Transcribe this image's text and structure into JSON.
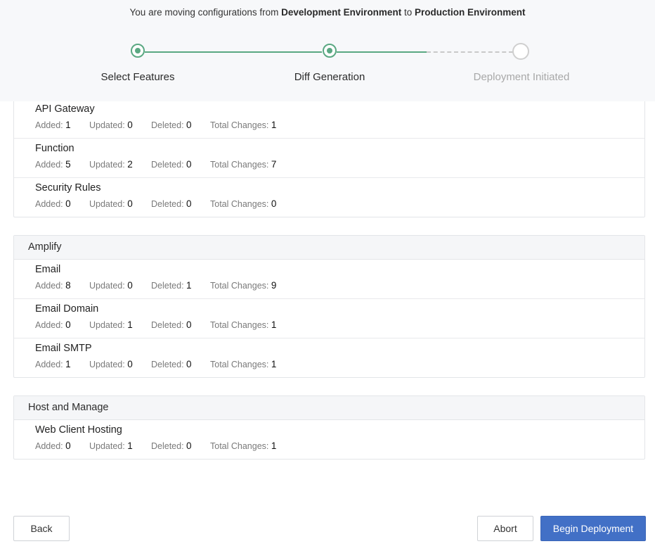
{
  "header": {
    "subtitle_prefix": "You are moving configurations from ",
    "source_env": "Development Environment",
    "subtitle_mid": " to ",
    "target_env": "Production Environment"
  },
  "stepper": {
    "steps": [
      {
        "label": "Select Features",
        "status": "completed"
      },
      {
        "label": "Diff Generation",
        "status": "current"
      },
      {
        "label": "Deployment Initiated",
        "status": "pending"
      }
    ],
    "colors": {
      "completed": "#5aa882",
      "pending": "#cfcfcf"
    }
  },
  "stat_labels": {
    "added": "Added: ",
    "updated": "Updated: ",
    "deleted": "Deleted: ",
    "total": "Total Changes: "
  },
  "groups": [
    {
      "title": "",
      "items": [
        {
          "name": "API Gateway",
          "added": "1",
          "updated": "0",
          "deleted": "0",
          "total": "1"
        },
        {
          "name": "Function",
          "added": "5",
          "updated": "2",
          "deleted": "0",
          "total": "7"
        },
        {
          "name": "Security Rules",
          "added": "0",
          "updated": "0",
          "deleted": "0",
          "total": "0"
        }
      ]
    },
    {
      "title": "Amplify",
      "items": [
        {
          "name": "Email",
          "added": "8",
          "updated": "0",
          "deleted": "1",
          "total": "9"
        },
        {
          "name": "Email Domain",
          "added": "0",
          "updated": "1",
          "deleted": "0",
          "total": "1"
        },
        {
          "name": "Email SMTP",
          "added": "1",
          "updated": "0",
          "deleted": "0",
          "total": "1"
        }
      ]
    },
    {
      "title": "Host and Manage",
      "items": [
        {
          "name": "Web Client Hosting",
          "added": "0",
          "updated": "1",
          "deleted": "0",
          "total": "1"
        }
      ]
    }
  ],
  "footer": {
    "back_label": "Back",
    "abort_label": "Abort",
    "begin_label": "Begin Deployment",
    "primary_color": "#4270c6"
  }
}
